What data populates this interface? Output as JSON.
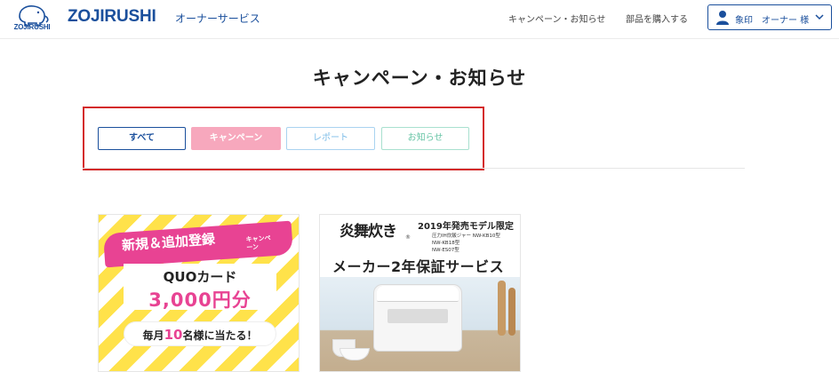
{
  "header": {
    "logo_mark_text": "ZOJIRUSHI",
    "logo_text": "ZOJIRUSHI",
    "logo_sub": "オーナーサービス",
    "nav": {
      "campaign_link": "キャンペーン・お知らせ",
      "parts_link": "部品を購入する"
    },
    "user_button_label": "象印　オーナー 様"
  },
  "page_title": "キャンペーン・お知らせ",
  "filters": {
    "all": "すべて",
    "campaign": "キャンペーン",
    "report": "レポート",
    "news": "お知らせ"
  },
  "cards": [
    {
      "headline": "新規＆追加登録",
      "headline_sub": "キャンペーン",
      "line1": "QUOカード",
      "line2": "3,000円分",
      "pill_pre": "毎月",
      "pill_num": "10",
      "pill_post": "名様に当たる！"
    },
    {
      "brand": "炎舞炊き",
      "brand_reg": "®",
      "model_title": "2019年発売モデル限定",
      "model_line1": "圧力IH炊飯ジャー NW-KB10型",
      "model_line2": "NW-KB18型",
      "model_line3": "NW-ES07型",
      "service_title": "メーカー2年保証サービス"
    }
  ],
  "colors": {
    "brand_blue": "#1a4f9c",
    "campaign_pink": "#f7a8bd",
    "report_blue": "#7dbde8",
    "news_green": "#66c4a5",
    "highlight_frame": "#d42a2a"
  }
}
